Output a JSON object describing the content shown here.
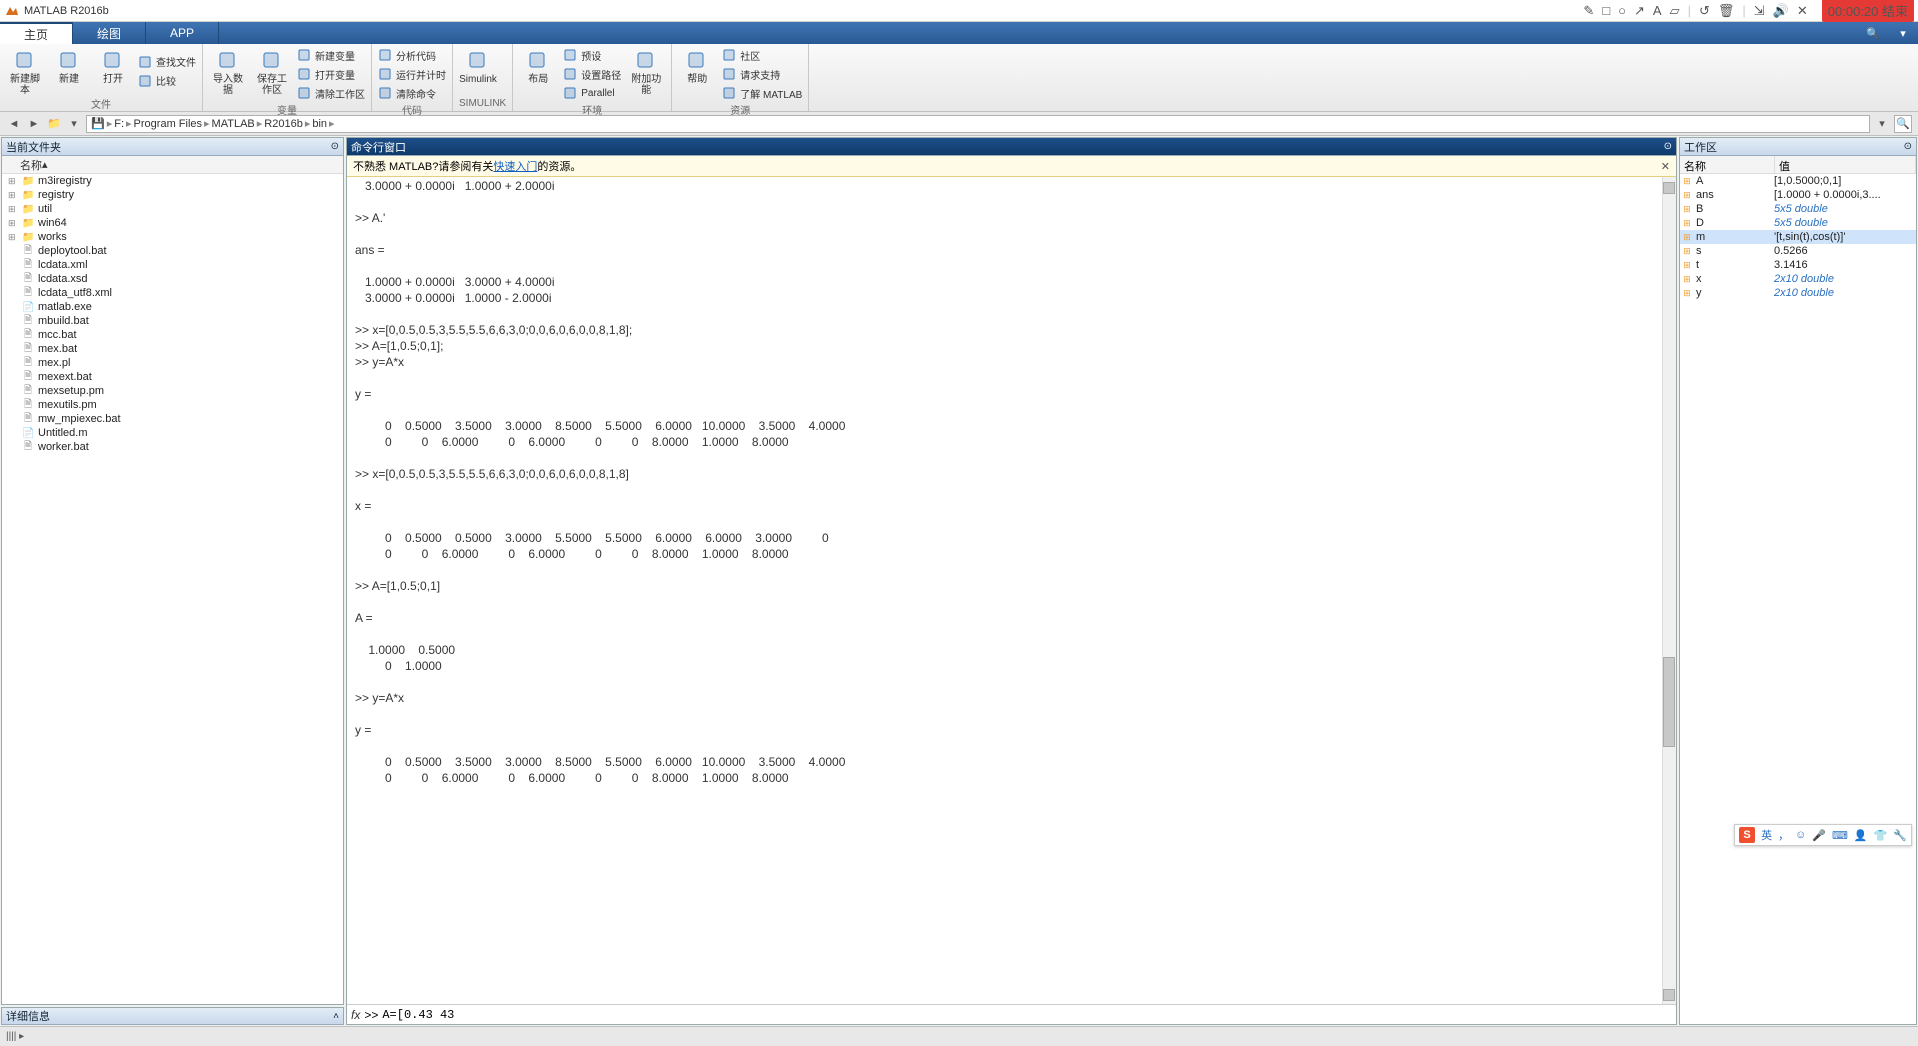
{
  "app": {
    "title": "MATLAB R2016b"
  },
  "recording": "00:00:20 结束",
  "tabs": [
    {
      "label": "主页",
      "active": true
    },
    {
      "label": "绘图",
      "active": false
    },
    {
      "label": "APP",
      "active": false
    }
  ],
  "ribbon": {
    "groups": [
      {
        "label": "文件",
        "large": [
          {
            "icon": "new-script-icon",
            "label": "新建脚本"
          },
          {
            "icon": "new-icon",
            "label": "新建"
          },
          {
            "icon": "open-icon",
            "label": "打开"
          }
        ],
        "small": [
          {
            "icon": "find-files-icon",
            "label": "查找文件"
          },
          {
            "icon": "compare-icon",
            "label": "比较"
          }
        ]
      },
      {
        "label": "变量",
        "large": [
          {
            "icon": "import-icon",
            "label": "导入数据"
          },
          {
            "icon": "save-ws-icon",
            "label": "保存工作区"
          }
        ],
        "small": [
          {
            "icon": "new-var-icon",
            "label": "新建变量"
          },
          {
            "icon": "open-var-icon",
            "label": "打开变量"
          },
          {
            "icon": "clear-ws-icon",
            "label": "清除工作区"
          }
        ]
      },
      {
        "label": "代码",
        "small": [
          {
            "icon": "analyze-icon",
            "label": "分析代码"
          },
          {
            "icon": "timing-icon",
            "label": "运行并计时"
          },
          {
            "icon": "clear-cmd-icon",
            "label": "清除命令"
          }
        ]
      },
      {
        "label": "SIMULINK",
        "large": [
          {
            "icon": "simulink-icon",
            "label": "Simulink"
          }
        ]
      },
      {
        "label": "环境",
        "large": [
          {
            "icon": "layout-icon",
            "label": "布局"
          }
        ],
        "small": [
          {
            "icon": "prefs-icon",
            "label": "预设"
          },
          {
            "icon": "setpath-icon",
            "label": "设置路径"
          },
          {
            "icon": "parallel-icon",
            "label": "Parallel"
          }
        ],
        "large2": [
          {
            "icon": "addons-icon",
            "label": "附加功能"
          }
        ]
      },
      {
        "label": "资源",
        "large": [
          {
            "icon": "help-icon",
            "label": "帮助"
          }
        ],
        "small": [
          {
            "icon": "community-icon",
            "label": "社区"
          },
          {
            "icon": "support-icon",
            "label": "请求支持"
          },
          {
            "icon": "learn-icon",
            "label": "了解 MATLAB"
          }
        ]
      }
    ]
  },
  "path": {
    "segments": [
      "F:",
      "Program Files",
      "MATLAB",
      "R2016b",
      "bin"
    ]
  },
  "browser": {
    "title": "当前文件夹",
    "col_name": "名称",
    "items": [
      {
        "name": "m3iregistry",
        "type": "folder",
        "expandable": true
      },
      {
        "name": "registry",
        "type": "folder",
        "expandable": true
      },
      {
        "name": "util",
        "type": "folder",
        "expandable": true
      },
      {
        "name": "win64",
        "type": "folder",
        "expandable": true
      },
      {
        "name": "works",
        "type": "folder",
        "expandable": true
      },
      {
        "name": "deploytool.bat",
        "type": "file"
      },
      {
        "name": "lcdata.xml",
        "type": "file"
      },
      {
        "name": "lcdata.xsd",
        "type": "file"
      },
      {
        "name": "lcdata_utf8.xml",
        "type": "file"
      },
      {
        "name": "matlab.exe",
        "type": "mfile"
      },
      {
        "name": "mbuild.bat",
        "type": "file"
      },
      {
        "name": "mcc.bat",
        "type": "file"
      },
      {
        "name": "mex.bat",
        "type": "file"
      },
      {
        "name": "mex.pl",
        "type": "file"
      },
      {
        "name": "mexext.bat",
        "type": "file"
      },
      {
        "name": "mexsetup.pm",
        "type": "file"
      },
      {
        "name": "mexutils.pm",
        "type": "file"
      },
      {
        "name": "mw_mpiexec.bat",
        "type": "file"
      },
      {
        "name": "Untitled.m",
        "type": "mfile"
      },
      {
        "name": "worker.bat",
        "type": "file"
      }
    ]
  },
  "details": {
    "title": "详细信息"
  },
  "cmd": {
    "title": "命令行窗口",
    "banner_pre": "不熟悉 MATLAB?请参阅有关",
    "banner_link": "快速入门",
    "banner_post": "的资源。",
    "body": "   3.0000 + 0.0000i   1.0000 + 2.0000i\n\n>> A.'\n\nans =\n\n   1.0000 + 0.0000i   3.0000 + 4.0000i\n   3.0000 + 0.0000i   1.0000 - 2.0000i\n\n>> x=[0,0.5,0.5,3,5.5,5.5,6,6,3,0;0,0,6,0,6,0,0,8,1,8];\n>> A=[1,0.5;0,1];\n>> y=A*x\n\ny =\n\n         0    0.5000    3.5000    3.0000    8.5000    5.5000    6.0000   10.0000    3.5000    4.0000\n         0         0    6.0000         0    6.0000         0         0    8.0000    1.0000    8.0000\n\n>> x=[0,0.5,0.5,3,5.5,5.5,6,6,3,0;0,0,6,0,6,0,0,8,1,8]\n\nx =\n\n         0    0.5000    0.5000    3.0000    5.5000    5.5000    6.0000    6.0000    3.0000         0\n         0         0    6.0000         0    6.0000         0         0    8.0000    1.0000    8.0000\n\n>> A=[1,0.5;0,1]\n\nA =\n\n    1.0000    0.5000\n         0    1.0000\n\n>> y=A*x\n\ny =\n\n         0    0.5000    3.5000    3.0000    8.5000    5.5000    6.0000   10.0000    3.5000    4.0000\n         0         0    6.0000         0    6.0000         0         0    8.0000    1.0000    8.0000\n",
    "prompt_prefix": ">> ",
    "input_value": "A=[0.43 43 "
  },
  "workspace": {
    "title": "工作区",
    "col_name": "名称",
    "col_value": "值",
    "vars": [
      {
        "name": "A",
        "value": "[1,0.5000;0,1]",
        "italic": false,
        "selected": false
      },
      {
        "name": "ans",
        "value": "[1.0000 + 0.0000i,3....",
        "italic": false,
        "selected": false
      },
      {
        "name": "B",
        "value": "5x5 double",
        "italic": true,
        "selected": false
      },
      {
        "name": "D",
        "value": "5x5 double",
        "italic": true,
        "selected": false
      },
      {
        "name": "m",
        "value": "'[t,sin(t),cos(t)]'",
        "italic": false,
        "selected": true
      },
      {
        "name": "s",
        "value": "0.5266",
        "italic": false,
        "selected": false
      },
      {
        "name": "t",
        "value": "3.1416",
        "italic": false,
        "selected": false
      },
      {
        "name": "x",
        "value": "2x10 double",
        "italic": true,
        "selected": false
      },
      {
        "name": "y",
        "value": "2x10 double",
        "italic": true,
        "selected": false
      }
    ]
  },
  "ime": {
    "lang": "英",
    "sep": "，"
  },
  "status": {
    "text": "|||| ▸"
  }
}
